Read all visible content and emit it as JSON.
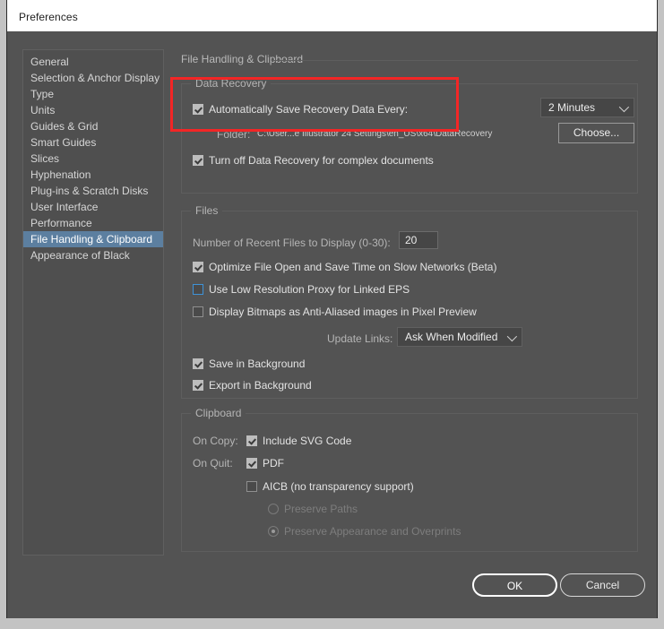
{
  "window": {
    "title": "Preferences"
  },
  "sidebar": {
    "items": [
      {
        "label": "General",
        "selected": false
      },
      {
        "label": "Selection & Anchor Display",
        "selected": false
      },
      {
        "label": "Type",
        "selected": false
      },
      {
        "label": "Units",
        "selected": false
      },
      {
        "label": "Guides & Grid",
        "selected": false
      },
      {
        "label": "Smart Guides",
        "selected": false
      },
      {
        "label": "Slices",
        "selected": false
      },
      {
        "label": "Hyphenation",
        "selected": false
      },
      {
        "label": "Plug-ins & Scratch Disks",
        "selected": false
      },
      {
        "label": "User Interface",
        "selected": false
      },
      {
        "label": "Performance",
        "selected": false
      },
      {
        "label": "File Handling & Clipboard",
        "selected": true
      },
      {
        "label": "Appearance of Black",
        "selected": false
      }
    ]
  },
  "pane": {
    "title": "File Handling & Clipboard",
    "data_recovery": {
      "legend": "Data Recovery",
      "auto_save_label": "Automatically Save Recovery Data Every:",
      "auto_save_checked": true,
      "interval_value": "2 Minutes",
      "folder_label": "Folder:",
      "folder_path": "C:\\User...e Illustrator 24 Settings\\en_US\\x64\\DataRecovery",
      "choose_label": "Choose...",
      "turn_off_label": "Turn off Data Recovery for complex documents",
      "turn_off_checked": true
    },
    "files": {
      "legend": "Files",
      "recent_files_label": "Number of Recent Files to Display (0-30):",
      "recent_files_value": "20",
      "optimize_label": "Optimize File Open and Save Time on Slow Networks (Beta)",
      "optimize_checked": true,
      "low_res_label": "Use Low Resolution Proxy for Linked EPS",
      "low_res_checked": false,
      "bitmaps_label": "Display Bitmaps as Anti-Aliased images in Pixel Preview",
      "bitmaps_checked": false,
      "update_links_label": "Update Links:",
      "update_links_value": "Ask When Modified",
      "save_bg_label": "Save in Background",
      "save_bg_checked": true,
      "export_bg_label": "Export in Background",
      "export_bg_checked": true
    },
    "clipboard": {
      "legend": "Clipboard",
      "on_copy_label": "On Copy:",
      "on_quit_label": "On Quit:",
      "include_svg_label": "Include SVG Code",
      "include_svg_checked": true,
      "pdf_label": "PDF",
      "pdf_checked": true,
      "aicb_label": "AICB (no transparency support)",
      "aicb_checked": false,
      "preserve_paths_label": "Preserve Paths",
      "preserve_paths_selected": false,
      "preserve_appearance_label": "Preserve Appearance and Overprints",
      "preserve_appearance_selected": true
    }
  },
  "footer": {
    "ok_label": "OK",
    "cancel_label": "Cancel"
  },
  "annotation": {
    "highlight_color": "#f32626"
  }
}
